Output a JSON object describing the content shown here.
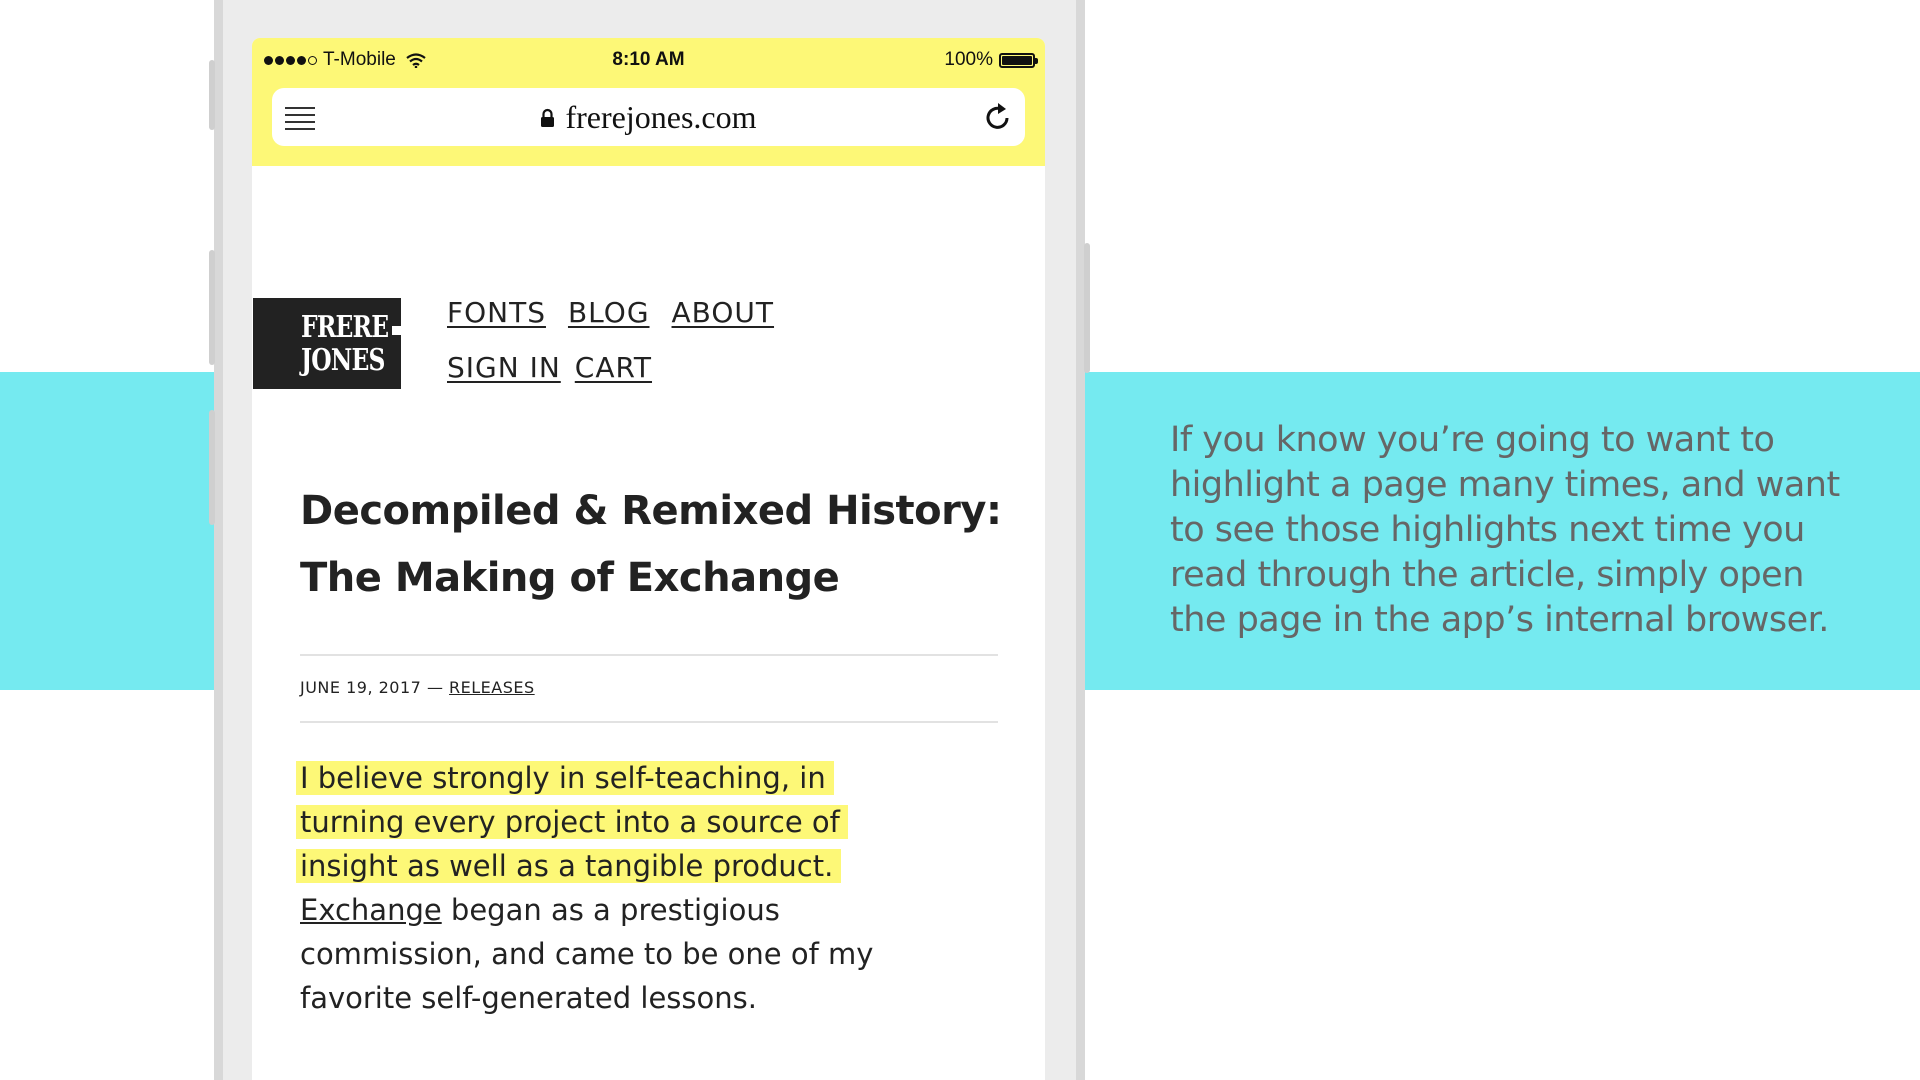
{
  "status_bar": {
    "carrier": "T-Mobile",
    "time": "8:10 AM",
    "battery": "100%"
  },
  "browser": {
    "url": "frerejones.com",
    "icons": [
      "menu-icon",
      "lock-icon",
      "reload-icon",
      "wifi-icon",
      "battery-icon"
    ]
  },
  "site": {
    "logo_line1": "FRERE",
    "logo_line2": "JONES",
    "nav": {
      "fonts": "FONTS",
      "blog": "BLOG",
      "about": "ABOUT",
      "sign_in": "SIGN IN",
      "cart": "CART"
    }
  },
  "article": {
    "title_line1": "Decompiled & Remixed History:",
    "title_line2": "The Making of Exchange",
    "date": "JUNE 19, 2017",
    "separator": "—",
    "category": "RELEASES",
    "highlight_line1": "I believe strongly in self-teaching, in",
    "highlight_line2": "turning every project into a source of",
    "highlight_line3": "insight as well as a tangible product.",
    "link_text": "Exchange",
    "body_after_link": " began as a prestigious commission, and came to be one of my favorite self-generated lessons."
  },
  "caption": {
    "text": "If you know you’re going to want to highlight a page many times, and want to see those highlights next time you read through the article, simply open the page in the app’s internal browser."
  },
  "colors": {
    "highlight_yellow": "#fdf877",
    "band_cyan": "#75eaf0"
  }
}
